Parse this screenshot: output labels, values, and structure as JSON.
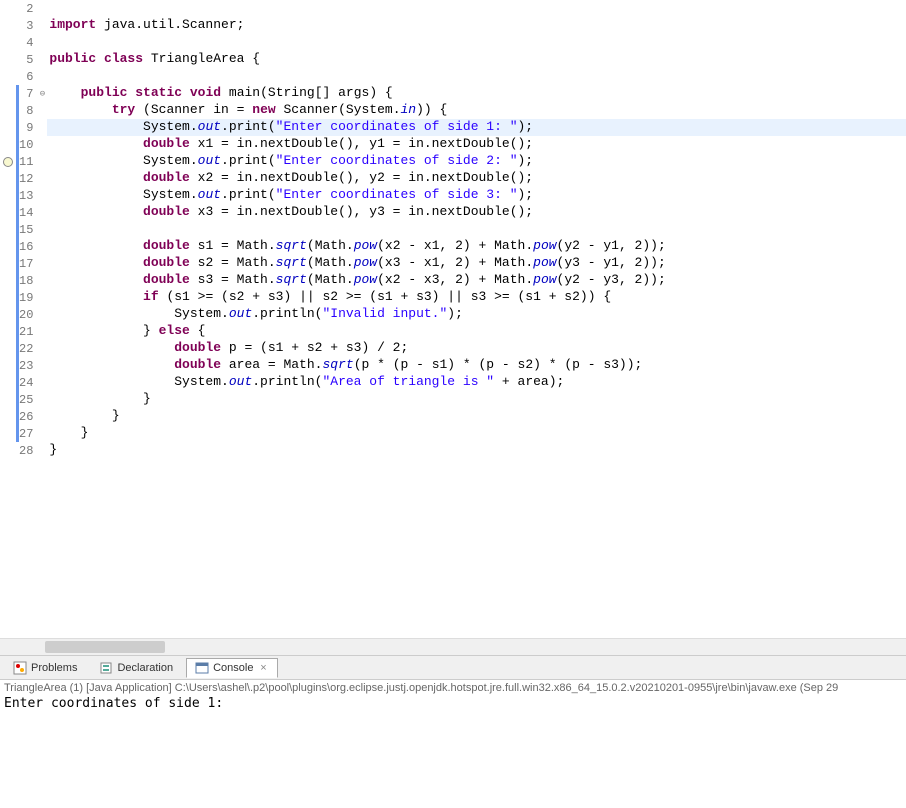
{
  "lines": [
    {
      "n": 2,
      "bar": false,
      "mark": null,
      "fold": null,
      "hl": false,
      "tokens": []
    },
    {
      "n": 3,
      "bar": false,
      "mark": null,
      "fold": null,
      "hl": false,
      "tokens": [
        {
          "c": "kw",
          "t": "import"
        },
        {
          "c": "norm",
          "t": " java.util.Scanner;"
        }
      ]
    },
    {
      "n": 4,
      "bar": false,
      "mark": null,
      "fold": null,
      "hl": false,
      "tokens": []
    },
    {
      "n": 5,
      "bar": false,
      "mark": null,
      "fold": null,
      "hl": false,
      "tokens": [
        {
          "c": "kw",
          "t": "public"
        },
        {
          "c": "norm",
          "t": " "
        },
        {
          "c": "kw",
          "t": "class"
        },
        {
          "c": "norm",
          "t": " TriangleArea {"
        }
      ]
    },
    {
      "n": 6,
      "bar": false,
      "mark": null,
      "fold": null,
      "hl": false,
      "tokens": []
    },
    {
      "n": 7,
      "bar": true,
      "mark": null,
      "fold": "⊖",
      "hl": false,
      "tokens": [
        {
          "c": "norm",
          "t": "    "
        },
        {
          "c": "kw",
          "t": "public"
        },
        {
          "c": "norm",
          "t": " "
        },
        {
          "c": "kw",
          "t": "static"
        },
        {
          "c": "norm",
          "t": " "
        },
        {
          "c": "kw",
          "t": "void"
        },
        {
          "c": "norm",
          "t": " main(String[] args) {"
        }
      ]
    },
    {
      "n": 8,
      "bar": true,
      "mark": null,
      "fold": null,
      "hl": false,
      "tokens": [
        {
          "c": "norm",
          "t": "        "
        },
        {
          "c": "kw",
          "t": "try"
        },
        {
          "c": "norm",
          "t": " (Scanner in = "
        },
        {
          "c": "kw",
          "t": "new"
        },
        {
          "c": "norm",
          "t": " Scanner(System."
        },
        {
          "c": "fld",
          "t": "in"
        },
        {
          "c": "norm",
          "t": ")) {"
        }
      ]
    },
    {
      "n": 9,
      "bar": true,
      "mark": null,
      "fold": null,
      "hl": true,
      "tokens": [
        {
          "c": "norm",
          "t": "            System."
        },
        {
          "c": "fld",
          "t": "out"
        },
        {
          "c": "norm",
          "t": ".print("
        },
        {
          "c": "str",
          "t": "\"Enter coordinates of side 1: \""
        },
        {
          "c": "norm",
          "t": ");"
        }
      ]
    },
    {
      "n": 10,
      "bar": true,
      "mark": null,
      "fold": null,
      "hl": false,
      "tokens": [
        {
          "c": "norm",
          "t": "            "
        },
        {
          "c": "kw",
          "t": "double"
        },
        {
          "c": "norm",
          "t": " x1 = in.nextDouble(), y1 = in.nextDouble();"
        }
      ]
    },
    {
      "n": 11,
      "bar": true,
      "mark": "o",
      "fold": null,
      "hl": false,
      "tokens": [
        {
          "c": "norm",
          "t": "            System."
        },
        {
          "c": "fld",
          "t": "out"
        },
        {
          "c": "norm",
          "t": ".print("
        },
        {
          "c": "str",
          "t": "\"Enter coordinates of side 2: \""
        },
        {
          "c": "norm",
          "t": ");"
        }
      ]
    },
    {
      "n": 12,
      "bar": true,
      "mark": null,
      "fold": null,
      "hl": false,
      "tokens": [
        {
          "c": "norm",
          "t": "            "
        },
        {
          "c": "kw",
          "t": "double"
        },
        {
          "c": "norm",
          "t": " x2 = in.nextDouble(), y2 = in.nextDouble();"
        }
      ]
    },
    {
      "n": 13,
      "bar": true,
      "mark": null,
      "fold": null,
      "hl": false,
      "tokens": [
        {
          "c": "norm",
          "t": "            System."
        },
        {
          "c": "fld",
          "t": "out"
        },
        {
          "c": "norm",
          "t": ".print("
        },
        {
          "c": "str",
          "t": "\"Enter coordinates of side 3: \""
        },
        {
          "c": "norm",
          "t": ");"
        }
      ]
    },
    {
      "n": 14,
      "bar": true,
      "mark": null,
      "fold": null,
      "hl": false,
      "tokens": [
        {
          "c": "norm",
          "t": "            "
        },
        {
          "c": "kw",
          "t": "double"
        },
        {
          "c": "norm",
          "t": " x3 = in.nextDouble(), y3 = in.nextDouble();"
        }
      ]
    },
    {
      "n": 15,
      "bar": true,
      "mark": null,
      "fold": null,
      "hl": false,
      "tokens": []
    },
    {
      "n": 16,
      "bar": true,
      "mark": null,
      "fold": null,
      "hl": false,
      "tokens": [
        {
          "c": "norm",
          "t": "            "
        },
        {
          "c": "kw",
          "t": "double"
        },
        {
          "c": "norm",
          "t": " s1 = Math."
        },
        {
          "c": "fld",
          "t": "sqrt"
        },
        {
          "c": "norm",
          "t": "(Math."
        },
        {
          "c": "fld",
          "t": "pow"
        },
        {
          "c": "norm",
          "t": "(x2 - x1, 2) + Math."
        },
        {
          "c": "fld",
          "t": "pow"
        },
        {
          "c": "norm",
          "t": "(y2 - y1, 2));"
        }
      ]
    },
    {
      "n": 17,
      "bar": true,
      "mark": null,
      "fold": null,
      "hl": false,
      "tokens": [
        {
          "c": "norm",
          "t": "            "
        },
        {
          "c": "kw",
          "t": "double"
        },
        {
          "c": "norm",
          "t": " s2 = Math."
        },
        {
          "c": "fld",
          "t": "sqrt"
        },
        {
          "c": "norm",
          "t": "(Math."
        },
        {
          "c": "fld",
          "t": "pow"
        },
        {
          "c": "norm",
          "t": "(x3 - x1, 2) + Math."
        },
        {
          "c": "fld",
          "t": "pow"
        },
        {
          "c": "norm",
          "t": "(y3 - y1, 2));"
        }
      ]
    },
    {
      "n": 18,
      "bar": true,
      "mark": null,
      "fold": null,
      "hl": false,
      "tokens": [
        {
          "c": "norm",
          "t": "            "
        },
        {
          "c": "kw",
          "t": "double"
        },
        {
          "c": "norm",
          "t": " s3 = Math."
        },
        {
          "c": "fld",
          "t": "sqrt"
        },
        {
          "c": "norm",
          "t": "(Math."
        },
        {
          "c": "fld",
          "t": "pow"
        },
        {
          "c": "norm",
          "t": "(x2 - x3, 2) + Math."
        },
        {
          "c": "fld",
          "t": "pow"
        },
        {
          "c": "norm",
          "t": "(y2 - y3, 2));"
        }
      ]
    },
    {
      "n": 19,
      "bar": true,
      "mark": null,
      "fold": null,
      "hl": false,
      "tokens": [
        {
          "c": "norm",
          "t": "            "
        },
        {
          "c": "kw",
          "t": "if"
        },
        {
          "c": "norm",
          "t": " (s1 >= (s2 + s3) || s2 >= (s1 + s3) || s3 >= (s1 + s2)) {"
        }
      ]
    },
    {
      "n": 20,
      "bar": true,
      "mark": null,
      "fold": null,
      "hl": false,
      "tokens": [
        {
          "c": "norm",
          "t": "                System."
        },
        {
          "c": "fld",
          "t": "out"
        },
        {
          "c": "norm",
          "t": ".println("
        },
        {
          "c": "str",
          "t": "\"Invalid input.\""
        },
        {
          "c": "norm",
          "t": ");"
        }
      ]
    },
    {
      "n": 21,
      "bar": true,
      "mark": null,
      "fold": null,
      "hl": false,
      "tokens": [
        {
          "c": "norm",
          "t": "            } "
        },
        {
          "c": "kw",
          "t": "else"
        },
        {
          "c": "norm",
          "t": " {"
        }
      ]
    },
    {
      "n": 22,
      "bar": true,
      "mark": null,
      "fold": null,
      "hl": false,
      "tokens": [
        {
          "c": "norm",
          "t": "                "
        },
        {
          "c": "kw",
          "t": "double"
        },
        {
          "c": "norm",
          "t": " p = (s1 + s2 + s3) / 2;"
        }
      ]
    },
    {
      "n": 23,
      "bar": true,
      "mark": null,
      "fold": null,
      "hl": false,
      "tokens": [
        {
          "c": "norm",
          "t": "                "
        },
        {
          "c": "kw",
          "t": "double"
        },
        {
          "c": "norm",
          "t": " area = Math."
        },
        {
          "c": "fld",
          "t": "sqrt"
        },
        {
          "c": "norm",
          "t": "(p * (p - s1) * (p - s2) * (p - s3));"
        }
      ]
    },
    {
      "n": 24,
      "bar": true,
      "mark": null,
      "fold": null,
      "hl": false,
      "tokens": [
        {
          "c": "norm",
          "t": "                System."
        },
        {
          "c": "fld",
          "t": "out"
        },
        {
          "c": "norm",
          "t": ".println("
        },
        {
          "c": "str",
          "t": "\"Area of triangle is \""
        },
        {
          "c": "norm",
          "t": " + area);"
        }
      ]
    },
    {
      "n": 25,
      "bar": true,
      "mark": null,
      "fold": null,
      "hl": false,
      "tokens": [
        {
          "c": "norm",
          "t": "            }"
        }
      ]
    },
    {
      "n": 26,
      "bar": true,
      "mark": null,
      "fold": null,
      "hl": false,
      "tokens": [
        {
          "c": "norm",
          "t": "        }"
        }
      ]
    },
    {
      "n": 27,
      "bar": true,
      "mark": null,
      "fold": null,
      "hl": false,
      "tokens": [
        {
          "c": "norm",
          "t": "    }"
        }
      ]
    },
    {
      "n": 28,
      "bar": false,
      "mark": null,
      "fold": null,
      "hl": false,
      "tokens": [
        {
          "c": "norm",
          "t": "}"
        }
      ]
    }
  ],
  "tabs": {
    "problems": "Problems",
    "declaration": "Declaration",
    "console": "Console"
  },
  "console": {
    "desc": "TriangleArea (1) [Java Application] C:\\Users\\ashel\\.p2\\pool\\plugins\\org.eclipse.justj.openjdk.hotspot.jre.full.win32.x86_64_15.0.2.v20210201-0955\\jre\\bin\\javaw.exe  (Sep 29",
    "output": "Enter coordinates of side 1: "
  }
}
